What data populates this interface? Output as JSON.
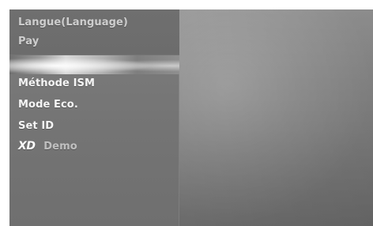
{
  "menu": {
    "items": [
      {
        "label": "Langue(Language)"
      },
      {
        "label": "Pay"
      },
      {
        "label": "Méthode ISM"
      },
      {
        "label": "Mode Eco."
      },
      {
        "label": "Set ID"
      },
      {
        "label": "Demo",
        "logo_text": "XD"
      }
    ]
  },
  "colors": {
    "panel": "#747474",
    "highlight": "#d9d9d9",
    "text": "#f5f5f5",
    "background": "#8e8e8e"
  }
}
